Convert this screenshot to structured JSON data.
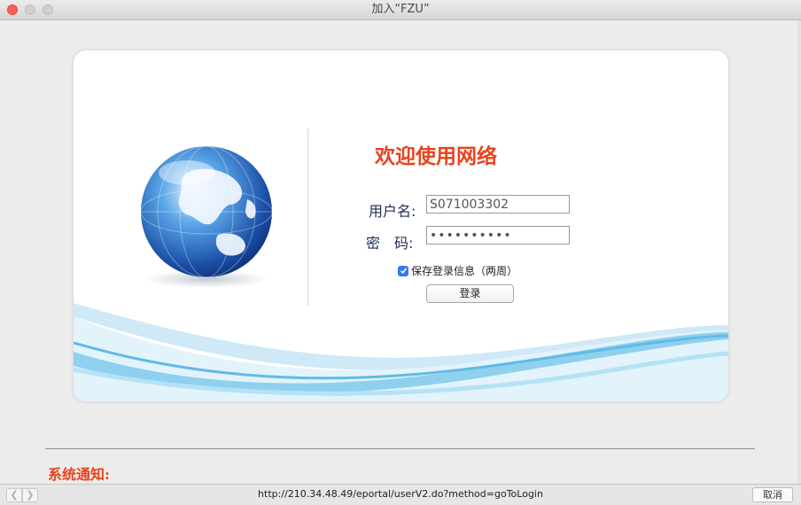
{
  "window": {
    "title": "加入“FZU”"
  },
  "login": {
    "welcome": "欢迎使用网络",
    "username_label": "用户名:",
    "password_label": "密　码:",
    "username_value": "S071003302",
    "password_value": "••••••••••",
    "remember_label": "保存登录信息（两周）",
    "remember_checked": true,
    "login_button": "登录"
  },
  "notice": {
    "title": "系统通知:"
  },
  "statusbar": {
    "url": "http://210.34.48.49/eportal/userV2.do?method=goToLogin",
    "cancel_label": "取消",
    "back_icon": "chevron-left-icon",
    "forward_icon": "chevron-right-icon"
  },
  "colors": {
    "accent": "#e8431d",
    "label": "#1f2d55",
    "checkbox": "#3478f6"
  }
}
